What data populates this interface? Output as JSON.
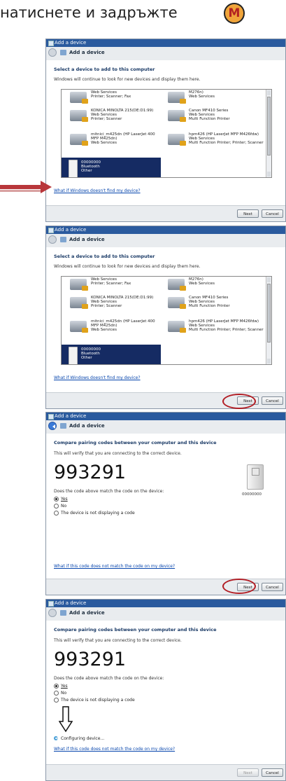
{
  "instruction": "натиснете и задръжте",
  "logo_letter": "M",
  "colors": {
    "title_bar": "#2a5a9e",
    "selected_row": "#152b63",
    "annotation_red": "#b21d24",
    "link": "#0645ad"
  },
  "dialog": {
    "title_bar": "Add a device",
    "nav_title": "Add a device",
    "select_heading": "Select a device to add to this computer",
    "select_sub": "Windows will continue to look for new devices and display them here.",
    "help_link_find": "What if Windows doesn't find my device?",
    "compare_heading": "Compare pairing codes between your computer and this device",
    "compare_sub": "This will verify that you are connecting to the correct device.",
    "pairing_code": "993291",
    "match_question": "Does the code above match the code on the device:",
    "option_yes": "Yes",
    "option_no": "No",
    "option_none": "The device is not displaying a code",
    "device_name": "00000000",
    "configuring": "Configuring device...",
    "help_link_code": "What if this code does not match the code on my device?",
    "next_label": "Next",
    "cancel_label": "Cancel"
  },
  "devices": [
    {
      "name": "",
      "type": "Web Services",
      "cat": "Printer; Scanner; Fax"
    },
    {
      "name": "M276n)",
      "type": "Web Services",
      "cat": ""
    },
    {
      "name": "KONICA MINOLTA 215(DE:D1:99)",
      "type": "Web Services",
      "cat": "Printer; Scanner"
    },
    {
      "name": "Canon MF410 Series",
      "type": "Web Services",
      "cat": "Multi Function Printer"
    },
    {
      "name": "mitnici_m425dn (HP LaserJet 400 MFP M425dn)",
      "type": "Web Services",
      "cat": ""
    },
    {
      "name": "hpm426 (HP LaserJet MFP M426fdw)",
      "type": "Web Services",
      "cat": "Multi Function Printer; Printer; Scanner"
    }
  ],
  "selected_device": {
    "name": "00000000",
    "type": "Bluetooth",
    "cat": "Other"
  }
}
